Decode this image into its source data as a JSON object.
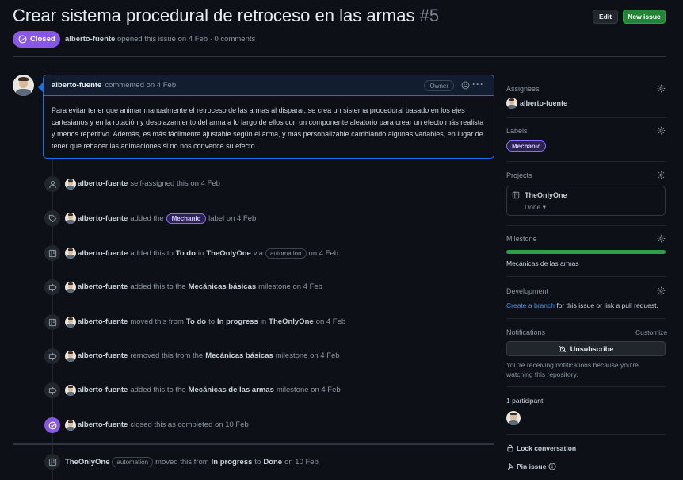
{
  "issue": {
    "title": "Crear sistema procedural de retroceso en las armas",
    "number": "#5",
    "state": "Closed",
    "author": "alberto-fuente",
    "opened_text": "opened this issue on 4 Feb · 0 comments"
  },
  "header_buttons": {
    "edit": "Edit",
    "new_issue": "New issue"
  },
  "comment": {
    "author": "alberto-fuente",
    "date_text": "commented on 4 Feb",
    "role_badge": "Owner",
    "body": "Para evitar tener que animar manualmente el retroceso de las armas al disparar, se crea un sistema procedural basado en los ejes cartesianos y en la rotación y desplazamiento del arma a lo largo de ellos con un componente aleatorio para crear un efecto más realista y menos repetitivo. Además, es más fácilmente ajustable según el arma, y más personalizable cambiando algunas variables, en lugar de tener que rehacer las animaciones si no nos convence su efecto."
  },
  "events": [
    {
      "icon": "person-icon",
      "actor": "alberto-fuente",
      "t1": "self-assigned this on 4 Feb"
    },
    {
      "icon": "tag-icon",
      "actor": "alberto-fuente",
      "t1": "added the",
      "label": "Mechanic",
      "t2": "label on 4 Feb"
    },
    {
      "icon": "project-icon",
      "actor": "alberto-fuente",
      "t1": "added this to",
      "b1": "To do",
      "t2": "in",
      "b2": "TheOnlyOne",
      "t3": "via",
      "pill": "automation",
      "t4": "on 4 Feb"
    },
    {
      "icon": "milestone-icon",
      "actor": "alberto-fuente",
      "t1": "added this to the",
      "b1": "Mecánicas básicas",
      "t2": "milestone on 4 Feb"
    },
    {
      "icon": "project-icon",
      "actor": "alberto-fuente",
      "t1": "moved this from",
      "b1": "To do",
      "t2": "to",
      "b2": "In progress",
      "t3": "in",
      "b3": "TheOnlyOne",
      "t4": "on 4 Feb"
    },
    {
      "icon": "milestone-icon",
      "actor": "alberto-fuente",
      "t1": "removed this from the",
      "b1": "Mecánicas básicas",
      "t2": "milestone on 4 Feb"
    },
    {
      "icon": "milestone-icon",
      "actor": "alberto-fuente",
      "t1": "added this to the",
      "b1": "Mecánicas de las armas",
      "t2": "milestone on 4 Feb"
    },
    {
      "icon": "issue-closed-icon",
      "actor": "alberto-fuente",
      "t1": "closed this as completed on 10 Feb"
    }
  ],
  "last_event": {
    "actor": "TheOnlyOne",
    "pill": "automation",
    "t1": "moved this from",
    "b1": "In progress",
    "t2": "to",
    "b2": "Done",
    "t3": "on 10 Feb"
  },
  "sidebar": {
    "assignees_label": "Assignees",
    "assignee": "alberto-fuente",
    "labels_label": "Labels",
    "label": "Mechanic",
    "projects_label": "Projects",
    "project_name": "TheOnlyOne",
    "project_status": "Done",
    "milestone_label": "Milestone",
    "milestone_progress": 1.0,
    "milestone_name": "Mecánicas de las armas",
    "development_label": "Development",
    "dev_link": "Create a branch",
    "dev_text": "for this issue or link a pull request.",
    "notifications_label": "Notifications",
    "customize": "Customize",
    "unsubscribe": "Unsubscribe",
    "notif_text": "You're receiving notifications because you're watching this repository.",
    "participants_label": "1 participant",
    "lock": "Lock conversation",
    "pin": "Pin issue"
  },
  "colors": {
    "accent": "#1f6feb",
    "closed": "#8957e5",
    "green": "#238636",
    "link": "#4493f8"
  }
}
